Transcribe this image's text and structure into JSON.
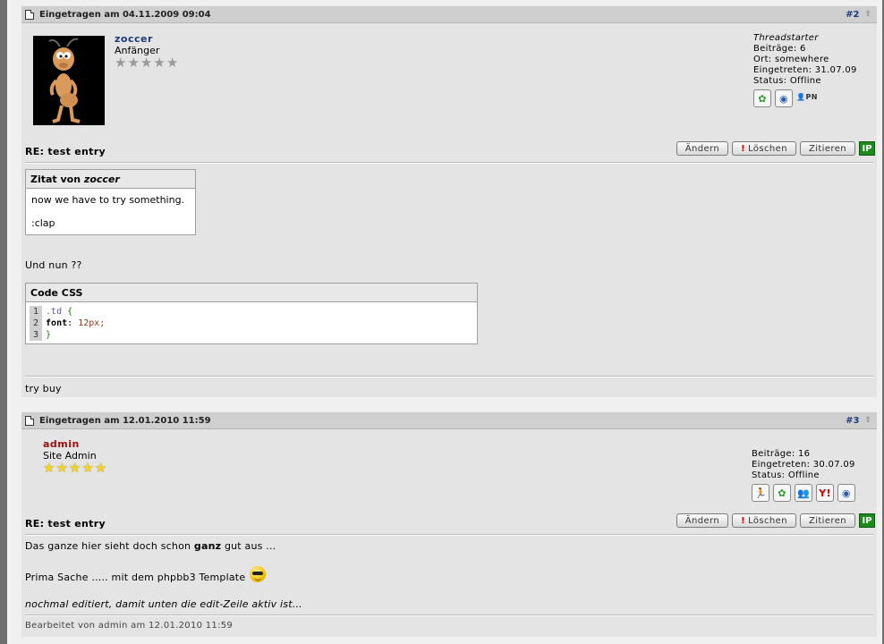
{
  "posts": [
    {
      "date": "Eingetragen am 04.11.2009 09:04",
      "number": "#2",
      "author": {
        "name": "zoccer",
        "name_color": "#1e3a78",
        "rank": "Anfänger",
        "stars": [
          "★",
          "★",
          "★",
          "★",
          "★"
        ],
        "info": [
          "Threadstarter",
          "Beiträge: 6",
          "Ort: somewhere",
          "Eingetreten: 31.07.09",
          "Status: Offline"
        ],
        "contacts": [
          "icq-icon",
          "website-icon",
          "pm-icon"
        ]
      },
      "title": "RE: test entry",
      "buttons": {
        "edit": "Ändern",
        "delete_mark": "!",
        "delete": "Löschen",
        "quote": "Zitieren",
        "ip": "IP"
      },
      "quote": {
        "label": "Zitat von",
        "author": "zoccer",
        "lines": [
          "now we have to try something.",
          ":clap"
        ]
      },
      "text": "Und nun ??",
      "code": {
        "label": "Code CSS",
        "line_numbers": [
          "1",
          "2",
          "3"
        ],
        "selector": ".td",
        "open_brace": "{",
        "property": "font",
        "colon": ":",
        "value": "12px;",
        "close_brace": "}"
      },
      "signature": "try buy"
    },
    {
      "date": "Eingetragen am 12.01.2010 11:59",
      "number": "#3",
      "author": {
        "name": "admin",
        "name_color": "#a01010",
        "rank": "Site Admin",
        "stars": [
          "★",
          "★",
          "★",
          "★",
          "★"
        ],
        "info": [
          "Beiträge: 16",
          "Eingetreten: 30.07.09",
          "Status: Offline"
        ],
        "contacts": [
          "aim-icon",
          "icq-icon",
          "msn-icon",
          "yahoo-icon",
          "website-icon"
        ]
      },
      "title": "RE: test entry",
      "buttons": {
        "edit": "Ändern",
        "delete_mark": "!",
        "delete": "Löschen",
        "quote": "Zitieren",
        "ip": "IP"
      },
      "body_line1_pre": "Das ganze hier sieht doch schon",
      "body_line1_bold": "ganz",
      "body_line1_post": "gut aus ...",
      "body_line2": "Prima Sache ..... mit dem phpbb3 Template",
      "body_line3": "nochmal editiert, damit unten die edit-Zeile aktiv ist...",
      "edited": "Bearbeitet von admin am 12.01.2010 11:59"
    }
  ]
}
